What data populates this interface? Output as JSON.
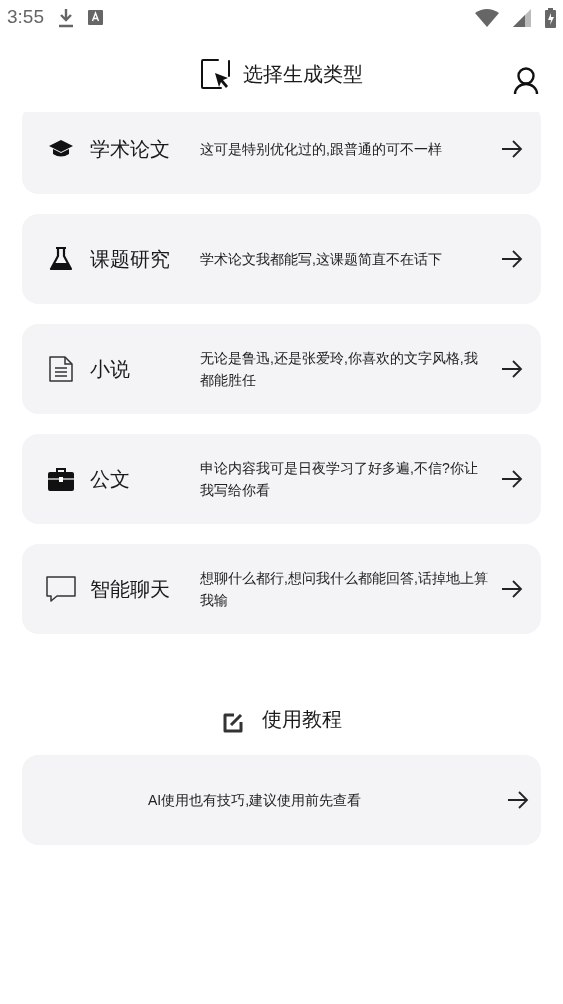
{
  "status_bar": {
    "time": "3:55"
  },
  "header": {
    "title": "选择生成类型"
  },
  "types": [
    {
      "kind": "cap",
      "label": "学术论文",
      "description": "这可是特别优化过的,跟普通的可不一样"
    },
    {
      "kind": "flask",
      "label": "课题研究",
      "description": "学术论文我都能写,这课题简直不在话下"
    },
    {
      "kind": "document",
      "label": "小说",
      "description": "无论是鲁迅,还是张爱玲,你喜欢的文字风格,我都能胜任"
    },
    {
      "kind": "briefcase",
      "label": "公文",
      "description": "申论内容我可是日夜学习了好多遍,不信?你让我写给你看"
    },
    {
      "kind": "chat",
      "label": "智能聊天",
      "description": "想聊什么都行,想问我什么都能回答,话掉地上算我输"
    }
  ],
  "tutorial": {
    "title": "使用教程",
    "description": "AI使用也有技巧,建议使用前先查看"
  }
}
